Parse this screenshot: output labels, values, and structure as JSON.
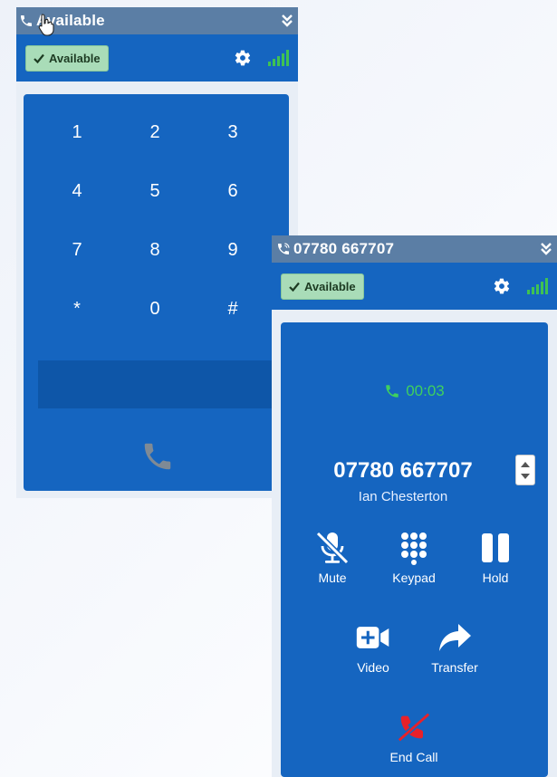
{
  "dialer": {
    "title": "Available",
    "status_label": "Available",
    "keys": [
      "1",
      "2",
      "3",
      "4",
      "5",
      "6",
      "7",
      "8",
      "9",
      "*",
      "0",
      "#"
    ]
  },
  "call": {
    "title": "07780 667707",
    "status_label": "Available",
    "timer": "00:03",
    "number": "07780 667707",
    "contact_name": "Ian Chesterton",
    "controls": {
      "mute": "Mute",
      "keypad": "Keypad",
      "hold": "Hold",
      "video": "Video",
      "transfer": "Transfer",
      "end_call": "End Call"
    }
  },
  "icons": {
    "collapse": "double-chevron-down-icon",
    "settings": "gear-icon",
    "signal": "signal-bars-icon",
    "check": "check-icon",
    "phone": "phone-icon",
    "mute": "microphone-slash-icon",
    "keypad": "grid-icon",
    "hold": "pause-icon",
    "video": "video-plus-icon",
    "transfer": "share-arrow-icon",
    "end_call": "phone-slash-icon"
  },
  "colors": {
    "titlebar": "#5b7ea5",
    "panel_blue": "#1565c0",
    "available_green": "#a9dcb8",
    "timer_green": "#3fd05e",
    "end_call_red": "#e8212a"
  }
}
